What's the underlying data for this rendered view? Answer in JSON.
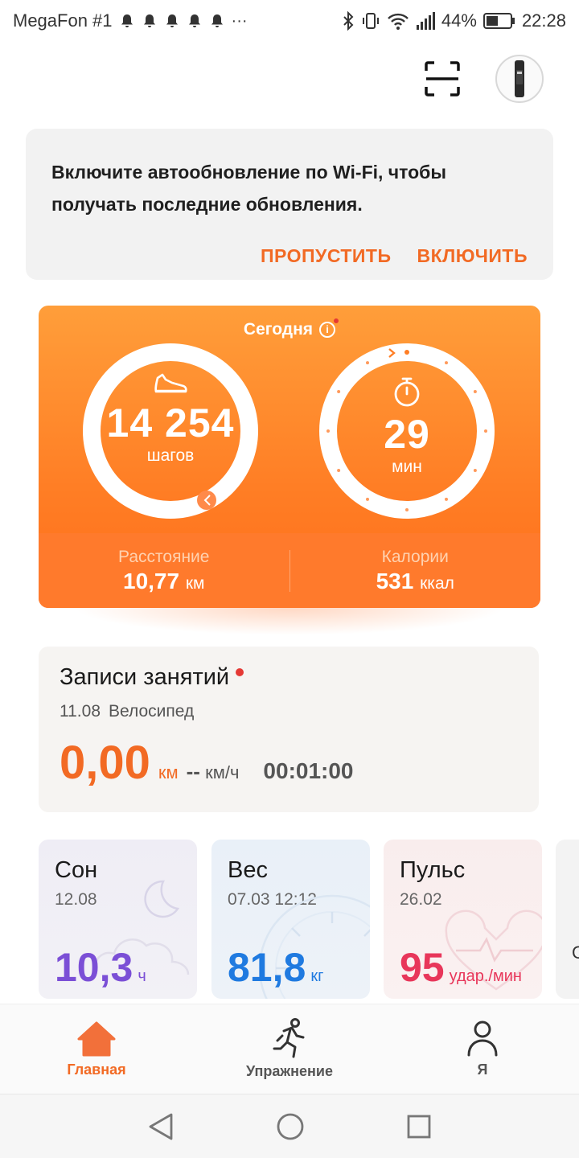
{
  "status_bar": {
    "carrier": "MegaFon #1",
    "notification_icons": [
      "bell-icon",
      "bell-icon",
      "bell-icon",
      "bell-icon",
      "bell-icon"
    ],
    "more": "···",
    "battery": "44%",
    "time": "22:28"
  },
  "top_bar": {
    "icons": [
      "scan-icon",
      "device-icon"
    ]
  },
  "banner": {
    "text": "Включите автообновление по Wi-Fi, чтобы получать последние обновления.",
    "skip_label": "ПРОПУСТИТЬ",
    "enable_label": "ВКЛЮЧИТЬ"
  },
  "activity": {
    "today_label": "Сегодня",
    "steps_value": "14 254",
    "steps_unit": "шагов",
    "steps_progress": 0.97,
    "minutes_value": "29",
    "minutes_unit": "мин",
    "distance_label": "Расстояние",
    "distance_value": "10,77",
    "distance_unit": "км",
    "calories_label": "Калории",
    "calories_value": "531",
    "calories_unit": "ккал"
  },
  "workout": {
    "title": "Записи занятий",
    "date": "11.08",
    "type": "Велосипед",
    "distance": "0,00",
    "distance_unit": "км",
    "speed": "--",
    "speed_unit": "км/ч",
    "duration": "00:01:00"
  },
  "tiles": {
    "sleep": {
      "title": "Сон",
      "date": "12.08",
      "value": "10,3",
      "unit": "ч",
      "color": "#7b4fd6"
    },
    "weight": {
      "title": "Вес",
      "date": "07.03 12:12",
      "value": "81,8",
      "unit": "кг",
      "color": "#1f7ae0"
    },
    "pulse": {
      "title": "Пульс",
      "date": "26.02",
      "value": "95",
      "unit": "удар./мин",
      "color": "#e8365a"
    },
    "peek_char": "С"
  },
  "bottom_nav": {
    "home": "Главная",
    "exercise": "Упражнение",
    "me": "Я"
  },
  "colors": {
    "accent": "#f26a24",
    "card_orange": "#ff7e25"
  }
}
